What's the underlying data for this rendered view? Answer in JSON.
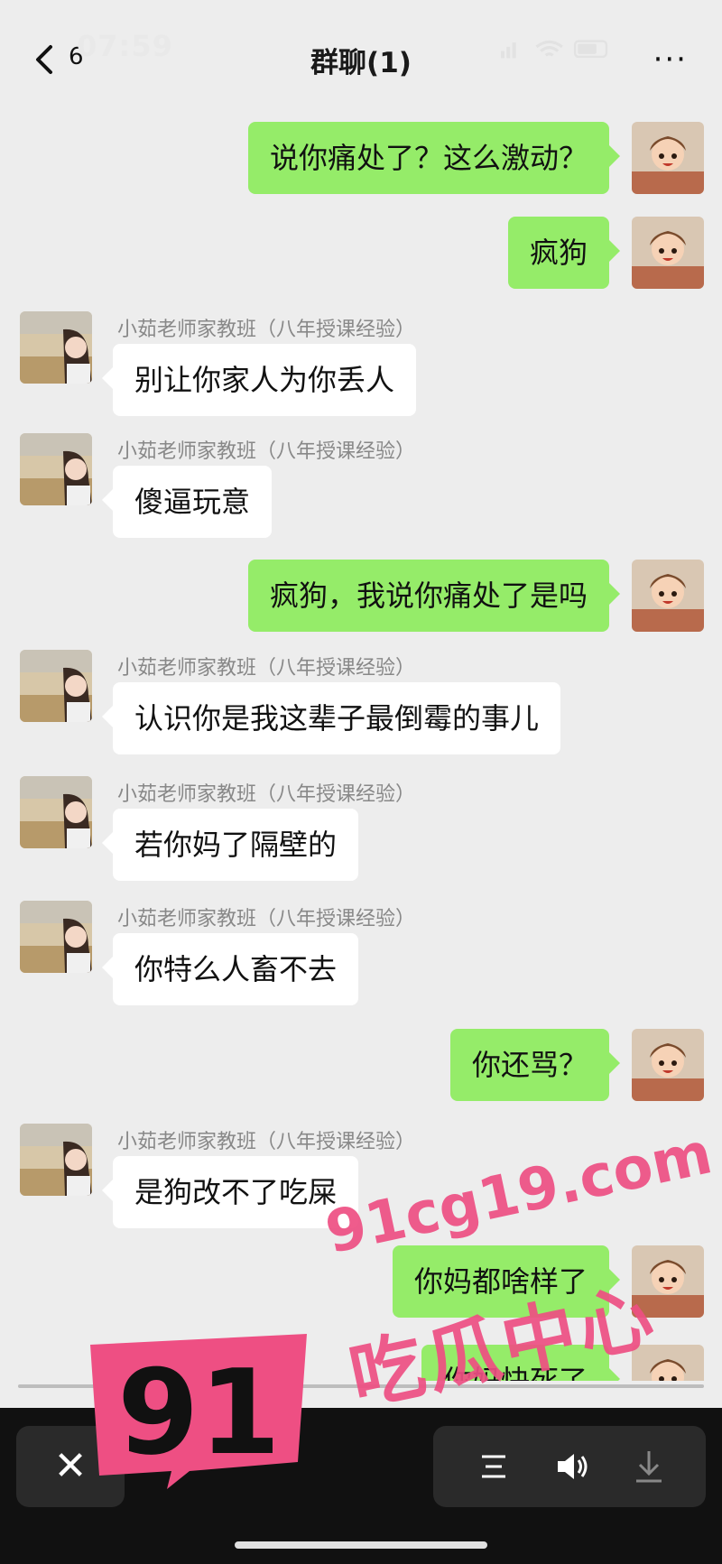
{
  "status": {
    "time": "07:59"
  },
  "nav": {
    "back_count": "6",
    "title": "群聊(1)",
    "more": "···"
  },
  "messages": [
    {
      "from": "me",
      "text": "说你痛处了？这么激动？"
    },
    {
      "from": "me",
      "text": "疯狗"
    },
    {
      "from": "other",
      "sender": "小茹老师家教班（八年授课经验）",
      "text": "别让你家人为你丢人"
    },
    {
      "from": "other",
      "sender": "小茹老师家教班（八年授课经验）",
      "text": "傻逼玩意"
    },
    {
      "from": "me",
      "text": "疯狗，我说你痛处了是吗"
    },
    {
      "from": "other",
      "sender": "小茹老师家教班（八年授课经验）",
      "text": "认识你是我这辈子最倒霉的事儿"
    },
    {
      "from": "other",
      "sender": "小茹老师家教班（八年授课经验）",
      "text": "若你妈了隔壁的"
    },
    {
      "from": "other",
      "sender": "小茹老师家教班（八年授课经验）",
      "text": "你特么人畜不去"
    },
    {
      "from": "me",
      "text": "你还骂？"
    },
    {
      "from": "other",
      "sender": "小茹老师家教班（八年授课经验）",
      "text": "是狗改不了吃屎"
    },
    {
      "from": "me",
      "text": "你妈都啥样了"
    },
    {
      "from": "me",
      "text": "你妈快死了"
    }
  ],
  "player": {
    "close": "✕"
  },
  "watermark": {
    "number": "91",
    "url": "91cg19.com",
    "name": "吃瓜中心"
  },
  "colors": {
    "my_bubble": "#95ec69",
    "other_bubble": "#ffffff",
    "watermark": "#ee4f83"
  }
}
